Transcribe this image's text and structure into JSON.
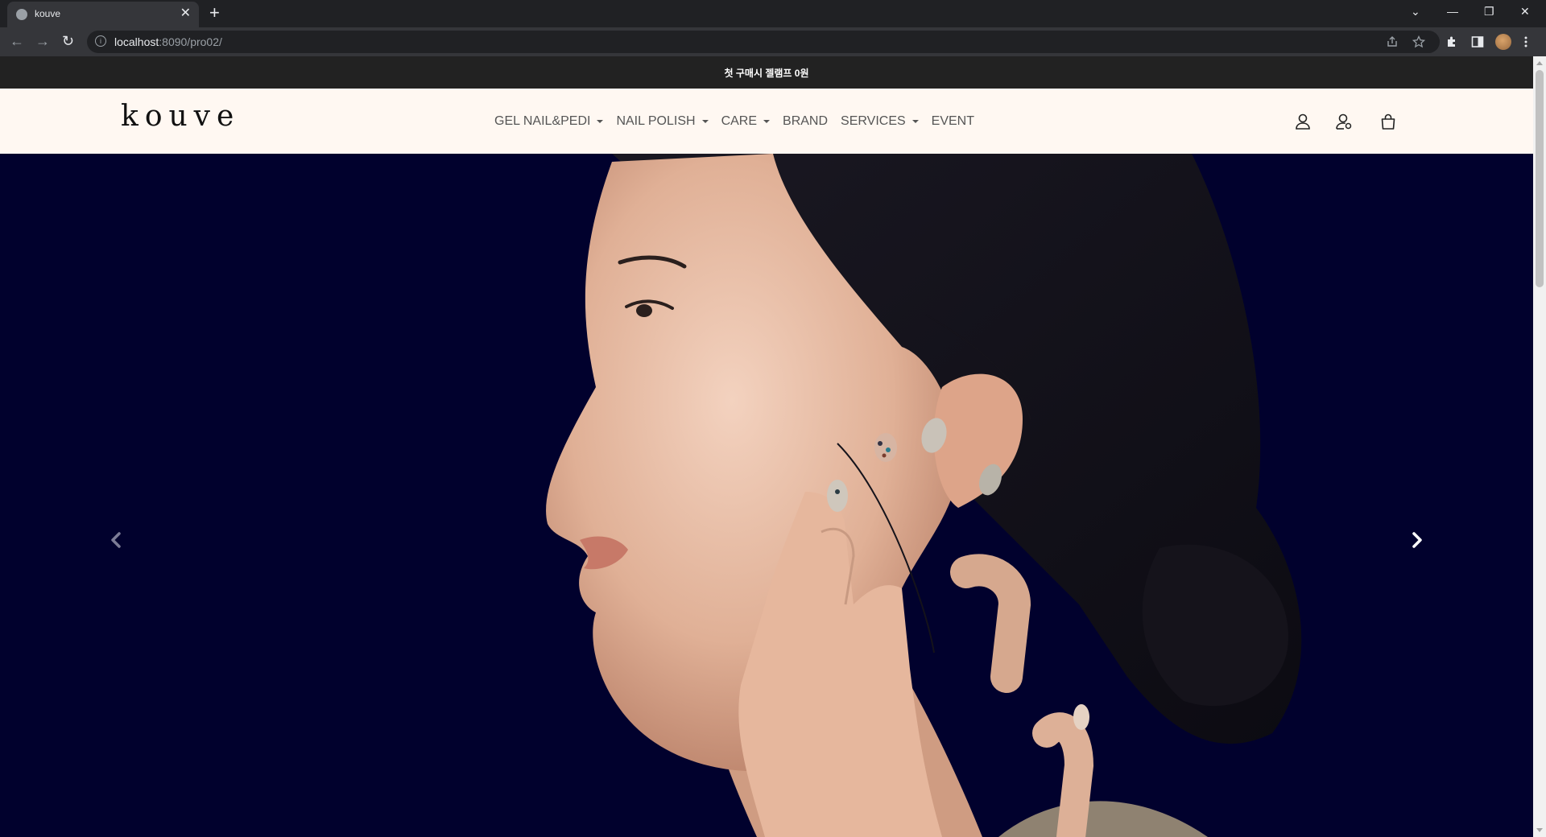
{
  "browser": {
    "tab_title": "kouve",
    "url_host": "localhost",
    "url_rest": ":8090/pro02/",
    "new_tab": "+",
    "close_tab": "✕",
    "back": "←",
    "forward": "→",
    "reload": "↻",
    "minimize": "—",
    "restore": "❐",
    "close_window": "✕",
    "tab_search": "⌄"
  },
  "promo": {
    "text": "첫 구매시 젤램프 0원"
  },
  "header": {
    "logo": "kouve",
    "nav": [
      {
        "label": "GEL NAIL&PEDI",
        "dropdown": true
      },
      {
        "label": "NAIL POLISH",
        "dropdown": true
      },
      {
        "label": "CARE",
        "dropdown": true
      },
      {
        "label": "BRAND",
        "dropdown": false
      },
      {
        "label": "SERVICES",
        "dropdown": true
      },
      {
        "label": "EVENT",
        "dropdown": false
      }
    ],
    "icons": [
      "user-icon",
      "user-settings-icon",
      "shopping-bag-icon"
    ]
  },
  "hero": {
    "background_color": "#000033",
    "image_subject": "woman-profile-with-painted-nails",
    "prev_icon": "chevron-left-icon",
    "next_icon": "chevron-right-icon"
  }
}
